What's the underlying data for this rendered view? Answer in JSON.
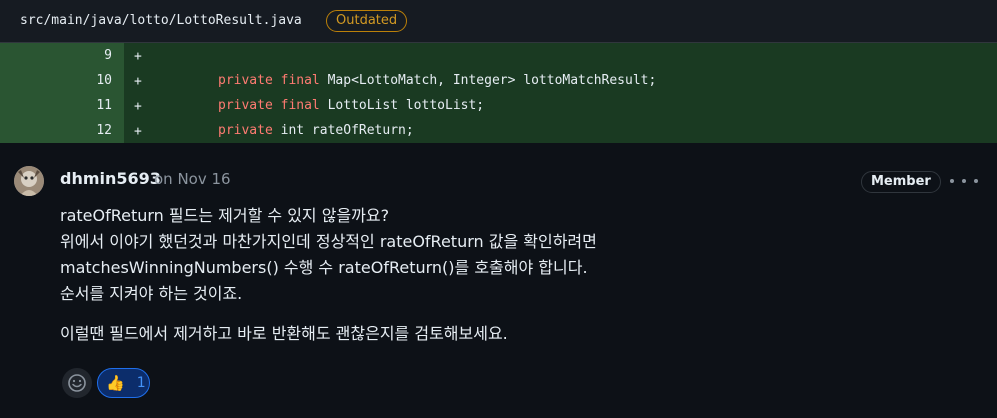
{
  "file": {
    "path": "src/main/java/lotto/LottoResult.java",
    "status_badge": "Outdated"
  },
  "diff": {
    "marker": "+",
    "lines": [
      {
        "num": "9",
        "tokens": [
          {
            "k": "",
            "t": ""
          }
        ]
      },
      {
        "num": "10",
        "tokens": [
          {
            "k": "kw",
            "t": "private"
          },
          {
            "k": "",
            "t": " "
          },
          {
            "k": "kw",
            "t": "final"
          },
          {
            "k": "",
            "t": " Map<LottoMatch, Integer> lottoMatchResult;"
          }
        ]
      },
      {
        "num": "11",
        "tokens": [
          {
            "k": "kw",
            "t": "private"
          },
          {
            "k": "",
            "t": " "
          },
          {
            "k": "kw",
            "t": "final"
          },
          {
            "k": "",
            "t": " LottoList lottoList;"
          }
        ]
      },
      {
        "num": "12",
        "tokens": [
          {
            "k": "kw",
            "t": "private"
          },
          {
            "k": "",
            "t": " int rateOfReturn;"
          }
        ]
      }
    ]
  },
  "comment": {
    "author": "dhmin5693",
    "timestamp": "on Nov 16",
    "role_badge": "Member",
    "paragraphs": [
      [
        "rateOfReturn 필드는 제거할 수 있지 않을까요?",
        "위에서 이야기 했던것과 마찬가지인데 정상적인 rateOfReturn 값을 확인하려면",
        "matchesWinningNumbers() 수행 수 rateOfReturn()를 호출해야 합니다.",
        "순서를 지켜야 하는 것이죠."
      ],
      [
        "이럴땐 필드에서 제거하고 바로 반환해도 괜찮은지를 검토해보세요."
      ]
    ],
    "reactions": [
      {
        "emoji": "👍",
        "count": "1",
        "icon": "thumbs-up-icon"
      }
    ]
  },
  "colors": {
    "background": "#0d1117",
    "diff_added_bg": "#1a3a22",
    "diff_gutter_bg": "#2a5532",
    "keyword": "#ff7b72",
    "outdated": "#d29922",
    "reaction_accent": "#1f6feb"
  }
}
